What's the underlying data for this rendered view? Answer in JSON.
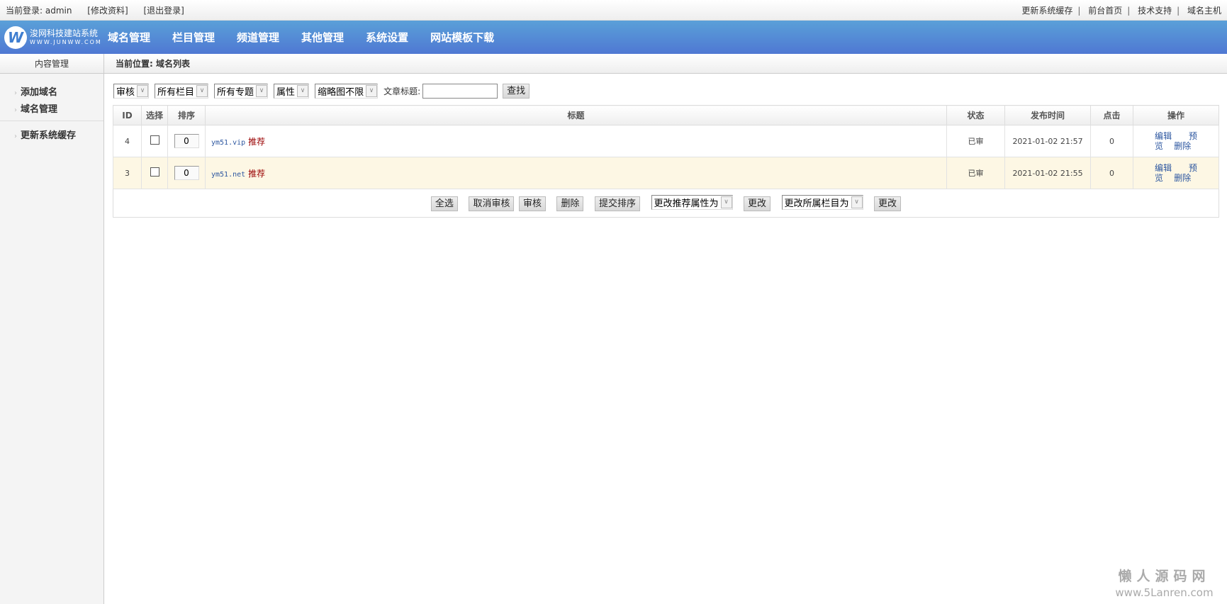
{
  "topbar": {
    "login": "当前登录: admin",
    "edit_profile": "[修改资料]",
    "logout": "[退出登录]",
    "links": [
      "更新系统缓存",
      "前台首页",
      "技术支持",
      "域名主机"
    ],
    "sep": "|"
  },
  "logo": {
    "icon": "W",
    "name": "浚网科技建站系统",
    "url": "WWW.JUNWW.COM"
  },
  "nav": [
    "域名管理",
    "栏目管理",
    "频道管理",
    "其他管理",
    "系统设置",
    "网站模板下载"
  ],
  "sidebar": {
    "title": "内容管理",
    "items": [
      "添加域名",
      "域名管理",
      "更新系统缓存"
    ]
  },
  "breadcrumb": "当前位置: 域名列表",
  "filters": {
    "status": "审核",
    "category": "所有栏目",
    "topic": "所有专题",
    "attr": "属性",
    "thumb": "缩略图不限",
    "title_label": "文章标题:",
    "title_value": "",
    "search": "查找"
  },
  "table": {
    "headers": [
      "ID",
      "选择",
      "排序",
      "标题",
      "状态",
      "发布时间",
      "点击",
      "操作"
    ],
    "rows": [
      {
        "id": "4",
        "order": "0",
        "title": "ym51.vip",
        "tag": "推荐",
        "status": "已审",
        "time": "2021-01-02 21:57",
        "clicks": "0",
        "edit": "编辑",
        "preview": "预览",
        "delete": "删除"
      },
      {
        "id": "3",
        "order": "0",
        "title": "ym51.net",
        "tag": "推荐",
        "status": "已审",
        "time": "2021-01-02 21:55",
        "clicks": "0",
        "edit": "编辑",
        "preview": "预览",
        "delete": "删除"
      }
    ]
  },
  "footer": {
    "select_all": "全选",
    "unapprove": "取消审核",
    "approve": "审核",
    "delete": "删除",
    "submit_order": "提交排序",
    "change_attr": "更改推荐属性为",
    "change1": "更改",
    "change_cat": "更改所属栏目为",
    "change2": "更改"
  },
  "watermark": {
    "name": "懒人源码网",
    "url": "www.5Lanren.com"
  }
}
